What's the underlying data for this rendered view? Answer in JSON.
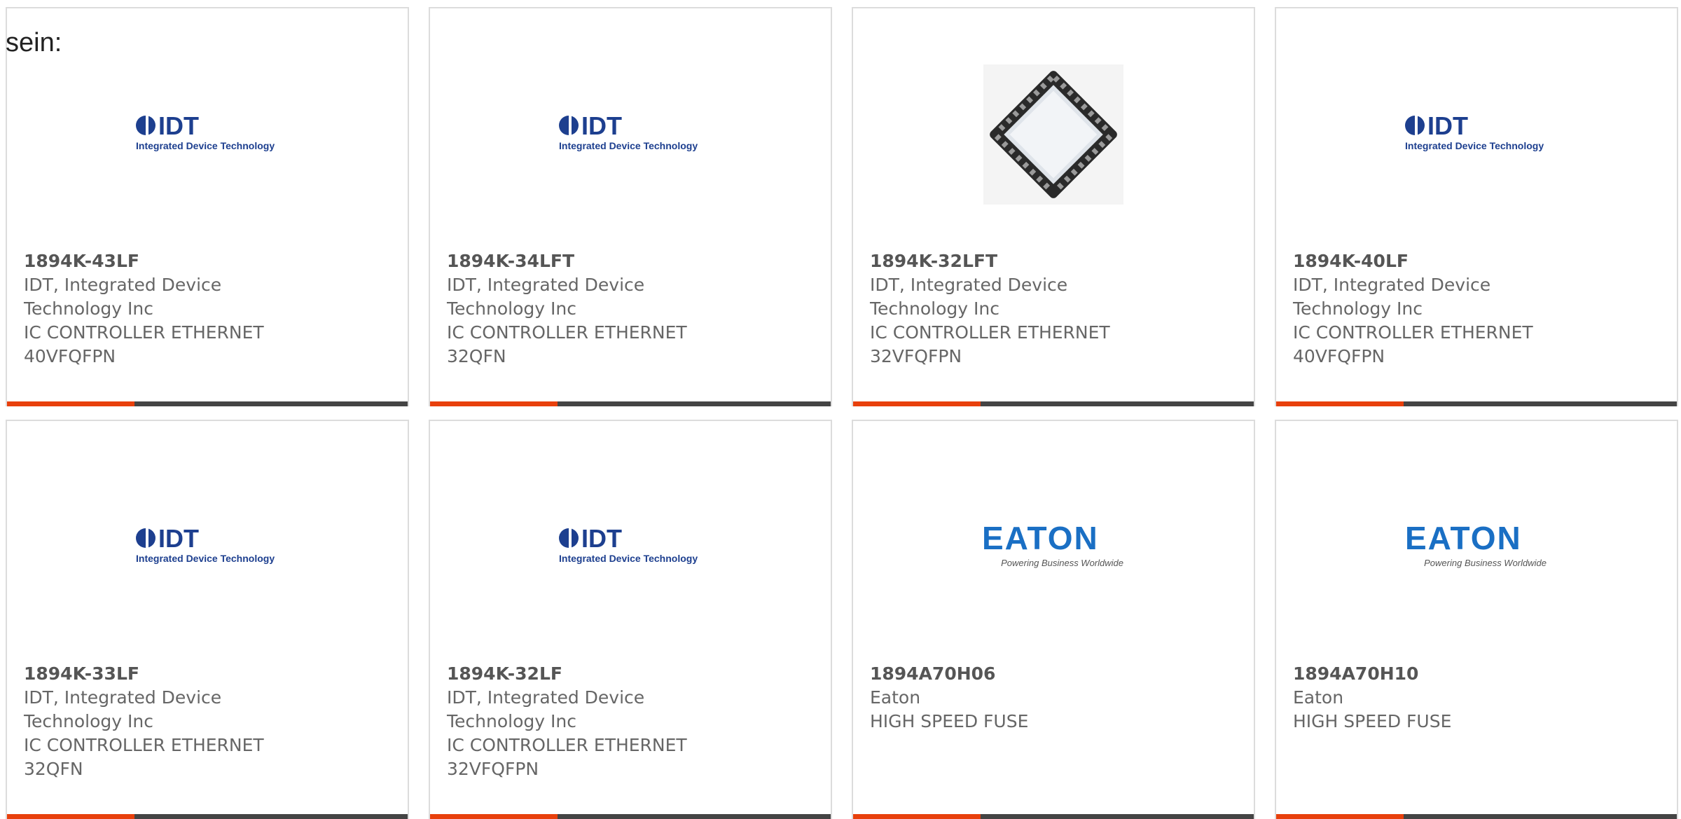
{
  "intro_text": "sein:",
  "colors": {
    "accent": "#e8400c",
    "bar": "#444444",
    "idt_blue": "#1d3f8f",
    "eaton_blue": "#1a6fc4"
  },
  "products": [
    {
      "part": "1894K-43LF",
      "manufacturer_line1": "IDT, Integrated Device",
      "manufacturer_line2": "Technology Inc",
      "desc_line1": "IC CONTROLLER ETHERNET",
      "desc_line2": "40VFQFPN",
      "image": "idt-logo"
    },
    {
      "part": "1894K-34LFT",
      "manufacturer_line1": "IDT, Integrated Device",
      "manufacturer_line2": "Technology Inc",
      "desc_line1": "IC CONTROLLER ETHERNET",
      "desc_line2": "32QFN",
      "image": "idt-logo"
    },
    {
      "part": "1894K-32LFT",
      "manufacturer_line1": "IDT, Integrated Device",
      "manufacturer_line2": "Technology Inc",
      "desc_line1": "IC CONTROLLER ETHERNET",
      "desc_line2": "32VFQFPN",
      "image": "qfn-chip-photo"
    },
    {
      "part": "1894K-40LF",
      "manufacturer_line1": "IDT, Integrated Device",
      "manufacturer_line2": "Technology Inc",
      "desc_line1": "IC CONTROLLER ETHERNET",
      "desc_line2": "40VFQFPN",
      "image": "idt-logo"
    },
    {
      "part": "1894K-33LF",
      "manufacturer_line1": "IDT, Integrated Device",
      "manufacturer_line2": "Technology Inc",
      "desc_line1": "IC CONTROLLER ETHERNET",
      "desc_line2": "32QFN",
      "image": "idt-logo"
    },
    {
      "part": "1894K-32LF",
      "manufacturer_line1": "IDT, Integrated Device",
      "manufacturer_line2": "Technology Inc",
      "desc_line1": "IC CONTROLLER ETHERNET",
      "desc_line2": "32VFQFPN",
      "image": "idt-logo"
    },
    {
      "part": "1894A70H06",
      "manufacturer_line1": "Eaton",
      "manufacturer_line2": "",
      "desc_line1": "HIGH SPEED FUSE",
      "desc_line2": "",
      "image": "eaton-logo"
    },
    {
      "part": "1894A70H10",
      "manufacturer_line1": "Eaton",
      "manufacturer_line2": "",
      "desc_line1": "HIGH SPEED FUSE",
      "desc_line2": "",
      "image": "eaton-logo"
    }
  ],
  "logos": {
    "idt_wordmark": "IDT",
    "idt_tagline": "Integrated Device Technology",
    "eaton_wordmark": "EATON",
    "eaton_tagline": "Powering Business Worldwide"
  }
}
